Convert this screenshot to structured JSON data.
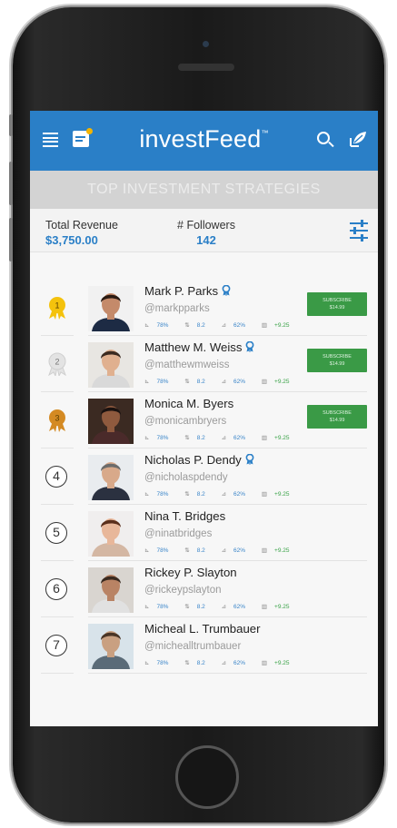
{
  "app": {
    "title": "investFeed",
    "trademark": "™"
  },
  "section": {
    "title": "TOP INVESTMENT STRATEGIES"
  },
  "stats": {
    "revenue_label": "Total Revenue",
    "revenue_value": "$3,750.00",
    "followers_label": "# Followers",
    "followers_value": "142"
  },
  "icons": {
    "menu": "menu-icon",
    "note": "notes-icon",
    "search": "search-icon",
    "leaf": "leaf-icon",
    "filter": "filter-icon",
    "verified": "verified-badge-icon"
  },
  "colors": {
    "brand": "#2a7fc7",
    "subscribe": "#3a9a46",
    "gold": "#f4c20d",
    "silver": "#e3e3e3",
    "bronze": "#d48a23"
  },
  "subscribe": {
    "label": "SUBSCRIBE",
    "price": "$14.99"
  },
  "traders": [
    {
      "rank": "1",
      "name": "Mark P. Parks",
      "handle": "@markpparks",
      "verified": true,
      "subscribe": true,
      "m1": "78%",
      "m2": "8.2",
      "m3": "62%",
      "m4": "+9.25",
      "medal": "gold"
    },
    {
      "rank": "2",
      "name": "Matthew M. Weiss",
      "handle": "@matthewmweiss",
      "verified": true,
      "subscribe": true,
      "m1": "78%",
      "m2": "8.2",
      "m3": "62%",
      "m4": "+9.25",
      "medal": "silver"
    },
    {
      "rank": "3",
      "name": "Monica M. Byers",
      "handle": "@monicambryers",
      "verified": false,
      "subscribe": true,
      "m1": "78%",
      "m2": "8.2",
      "m3": "62%",
      "m4": "+9.25",
      "medal": "bronze"
    },
    {
      "rank": "4",
      "name": "Nicholas P. Dendy",
      "handle": "@nicholaspdendy",
      "verified": true,
      "subscribe": false,
      "m1": "78%",
      "m2": "8.2",
      "m3": "62%",
      "m4": "+9.25",
      "medal": ""
    },
    {
      "rank": "5",
      "name": "Nina T. Bridges",
      "handle": "@ninatbridges",
      "verified": false,
      "subscribe": false,
      "m1": "78%",
      "m2": "8.2",
      "m3": "62%",
      "m4": "+9.25",
      "medal": ""
    },
    {
      "rank": "6",
      "name": "Rickey P. Slayton",
      "handle": "@rickeypslayton",
      "verified": false,
      "subscribe": false,
      "m1": "78%",
      "m2": "8.2",
      "m3": "62%",
      "m4": "+9.25",
      "medal": ""
    },
    {
      "rank": "7",
      "name": "Micheal L. Trumbauer",
      "handle": "@michealltrumbauer",
      "verified": false,
      "subscribe": false,
      "m1": "78%",
      "m2": "8.2",
      "m3": "62%",
      "m4": "+9.25",
      "medal": ""
    }
  ]
}
